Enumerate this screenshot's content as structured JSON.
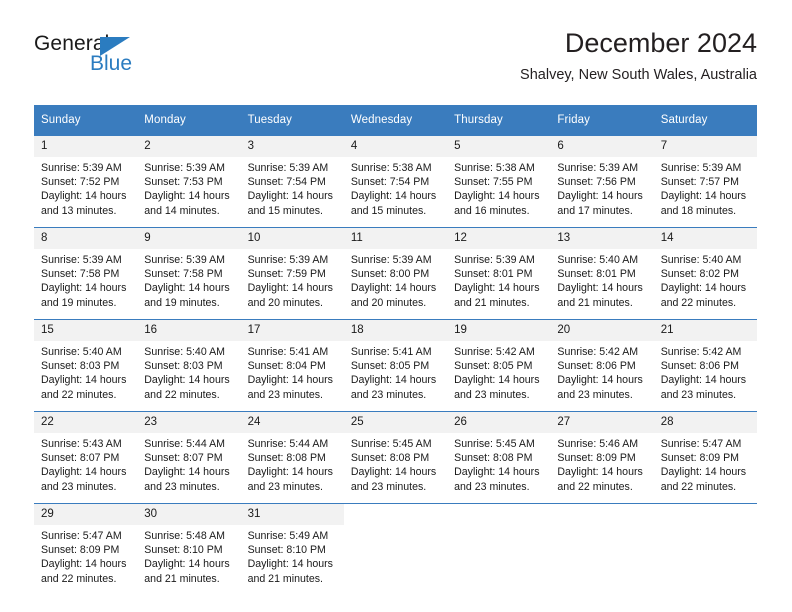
{
  "brand": {
    "name_part1": "General",
    "name_part2": "Blue",
    "accent_color": "#2b7cc0"
  },
  "header": {
    "month_title": "December 2024",
    "location": "Shalvey, New South Wales, Australia"
  },
  "calendar": {
    "header_bg": "#3a7cbe",
    "daynum_bg": "#f2f2f2",
    "weekday_headers": [
      "Sunday",
      "Monday",
      "Tuesday",
      "Wednesday",
      "Thursday",
      "Friday",
      "Saturday"
    ],
    "weeks": [
      [
        {
          "day": "1",
          "sunrise": "Sunrise: 5:39 AM",
          "sunset": "Sunset: 7:52 PM",
          "daylight": "Daylight: 14 hours and 13 minutes."
        },
        {
          "day": "2",
          "sunrise": "Sunrise: 5:39 AM",
          "sunset": "Sunset: 7:53 PM",
          "daylight": "Daylight: 14 hours and 14 minutes."
        },
        {
          "day": "3",
          "sunrise": "Sunrise: 5:39 AM",
          "sunset": "Sunset: 7:54 PM",
          "daylight": "Daylight: 14 hours and 15 minutes."
        },
        {
          "day": "4",
          "sunrise": "Sunrise: 5:38 AM",
          "sunset": "Sunset: 7:54 PM",
          "daylight": "Daylight: 14 hours and 15 minutes."
        },
        {
          "day": "5",
          "sunrise": "Sunrise: 5:38 AM",
          "sunset": "Sunset: 7:55 PM",
          "daylight": "Daylight: 14 hours and 16 minutes."
        },
        {
          "day": "6",
          "sunrise": "Sunrise: 5:39 AM",
          "sunset": "Sunset: 7:56 PM",
          "daylight": "Daylight: 14 hours and 17 minutes."
        },
        {
          "day": "7",
          "sunrise": "Sunrise: 5:39 AM",
          "sunset": "Sunset: 7:57 PM",
          "daylight": "Daylight: 14 hours and 18 minutes."
        }
      ],
      [
        {
          "day": "8",
          "sunrise": "Sunrise: 5:39 AM",
          "sunset": "Sunset: 7:58 PM",
          "daylight": "Daylight: 14 hours and 19 minutes."
        },
        {
          "day": "9",
          "sunrise": "Sunrise: 5:39 AM",
          "sunset": "Sunset: 7:58 PM",
          "daylight": "Daylight: 14 hours and 19 minutes."
        },
        {
          "day": "10",
          "sunrise": "Sunrise: 5:39 AM",
          "sunset": "Sunset: 7:59 PM",
          "daylight": "Daylight: 14 hours and 20 minutes."
        },
        {
          "day": "11",
          "sunrise": "Sunrise: 5:39 AM",
          "sunset": "Sunset: 8:00 PM",
          "daylight": "Daylight: 14 hours and 20 minutes."
        },
        {
          "day": "12",
          "sunrise": "Sunrise: 5:39 AM",
          "sunset": "Sunset: 8:01 PM",
          "daylight": "Daylight: 14 hours and 21 minutes."
        },
        {
          "day": "13",
          "sunrise": "Sunrise: 5:40 AM",
          "sunset": "Sunset: 8:01 PM",
          "daylight": "Daylight: 14 hours and 21 minutes."
        },
        {
          "day": "14",
          "sunrise": "Sunrise: 5:40 AM",
          "sunset": "Sunset: 8:02 PM",
          "daylight": "Daylight: 14 hours and 22 minutes."
        }
      ],
      [
        {
          "day": "15",
          "sunrise": "Sunrise: 5:40 AM",
          "sunset": "Sunset: 8:03 PM",
          "daylight": "Daylight: 14 hours and 22 minutes."
        },
        {
          "day": "16",
          "sunrise": "Sunrise: 5:40 AM",
          "sunset": "Sunset: 8:03 PM",
          "daylight": "Daylight: 14 hours and 22 minutes."
        },
        {
          "day": "17",
          "sunrise": "Sunrise: 5:41 AM",
          "sunset": "Sunset: 8:04 PM",
          "daylight": "Daylight: 14 hours and 23 minutes."
        },
        {
          "day": "18",
          "sunrise": "Sunrise: 5:41 AM",
          "sunset": "Sunset: 8:05 PM",
          "daylight": "Daylight: 14 hours and 23 minutes."
        },
        {
          "day": "19",
          "sunrise": "Sunrise: 5:42 AM",
          "sunset": "Sunset: 8:05 PM",
          "daylight": "Daylight: 14 hours and 23 minutes."
        },
        {
          "day": "20",
          "sunrise": "Sunrise: 5:42 AM",
          "sunset": "Sunset: 8:06 PM",
          "daylight": "Daylight: 14 hours and 23 minutes."
        },
        {
          "day": "21",
          "sunrise": "Sunrise: 5:42 AM",
          "sunset": "Sunset: 8:06 PM",
          "daylight": "Daylight: 14 hours and 23 minutes."
        }
      ],
      [
        {
          "day": "22",
          "sunrise": "Sunrise: 5:43 AM",
          "sunset": "Sunset: 8:07 PM",
          "daylight": "Daylight: 14 hours and 23 minutes."
        },
        {
          "day": "23",
          "sunrise": "Sunrise: 5:44 AM",
          "sunset": "Sunset: 8:07 PM",
          "daylight": "Daylight: 14 hours and 23 minutes."
        },
        {
          "day": "24",
          "sunrise": "Sunrise: 5:44 AM",
          "sunset": "Sunset: 8:08 PM",
          "daylight": "Daylight: 14 hours and 23 minutes."
        },
        {
          "day": "25",
          "sunrise": "Sunrise: 5:45 AM",
          "sunset": "Sunset: 8:08 PM",
          "daylight": "Daylight: 14 hours and 23 minutes."
        },
        {
          "day": "26",
          "sunrise": "Sunrise: 5:45 AM",
          "sunset": "Sunset: 8:08 PM",
          "daylight": "Daylight: 14 hours and 23 minutes."
        },
        {
          "day": "27",
          "sunrise": "Sunrise: 5:46 AM",
          "sunset": "Sunset: 8:09 PM",
          "daylight": "Daylight: 14 hours and 22 minutes."
        },
        {
          "day": "28",
          "sunrise": "Sunrise: 5:47 AM",
          "sunset": "Sunset: 8:09 PM",
          "daylight": "Daylight: 14 hours and 22 minutes."
        }
      ],
      [
        {
          "day": "29",
          "sunrise": "Sunrise: 5:47 AM",
          "sunset": "Sunset: 8:09 PM",
          "daylight": "Daylight: 14 hours and 22 minutes."
        },
        {
          "day": "30",
          "sunrise": "Sunrise: 5:48 AM",
          "sunset": "Sunset: 8:10 PM",
          "daylight": "Daylight: 14 hours and 21 minutes."
        },
        {
          "day": "31",
          "sunrise": "Sunrise: 5:49 AM",
          "sunset": "Sunset: 8:10 PM",
          "daylight": "Daylight: 14 hours and 21 minutes."
        },
        {
          "day": "",
          "sunrise": "",
          "sunset": "",
          "daylight": ""
        },
        {
          "day": "",
          "sunrise": "",
          "sunset": "",
          "daylight": ""
        },
        {
          "day": "",
          "sunrise": "",
          "sunset": "",
          "daylight": ""
        },
        {
          "day": "",
          "sunrise": "",
          "sunset": "",
          "daylight": ""
        }
      ]
    ]
  }
}
